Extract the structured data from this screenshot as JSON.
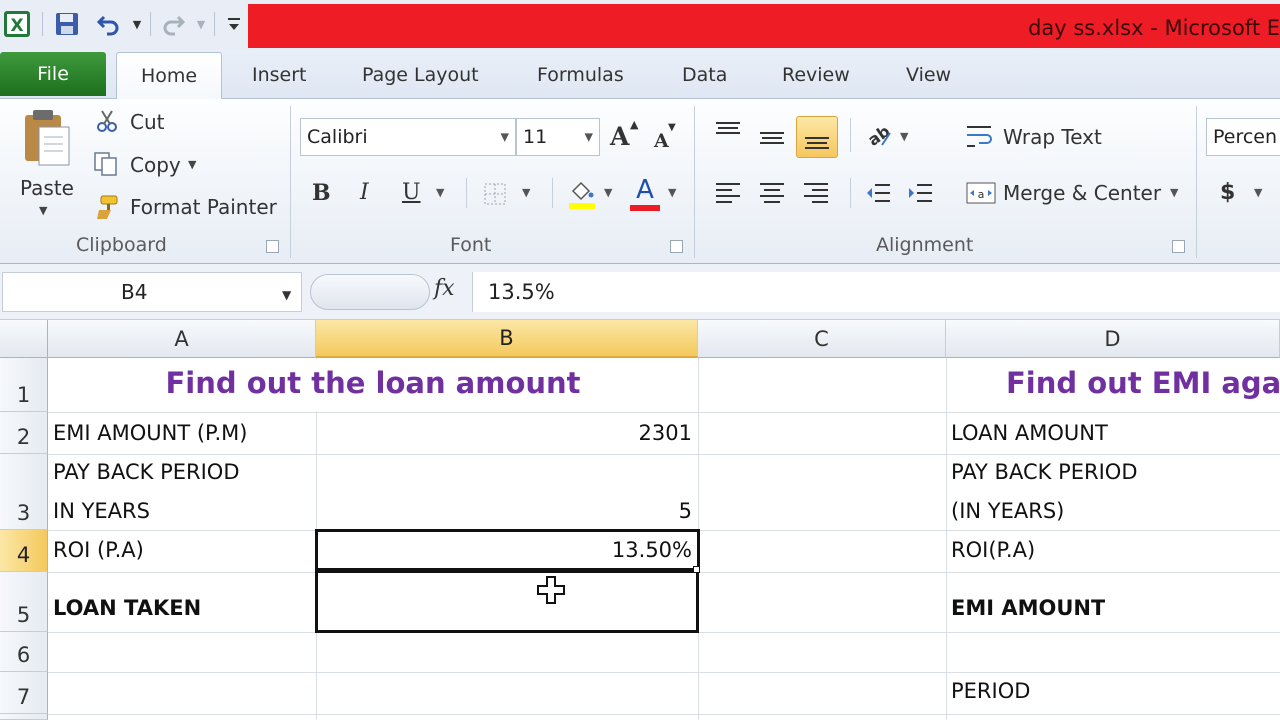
{
  "window": {
    "title": "day ss.xlsx  -  Microsoft E"
  },
  "tabs": [
    "File",
    "Home",
    "Insert",
    "Page Layout",
    "Formulas",
    "Data",
    "Review",
    "View"
  ],
  "clipboard": {
    "paste": "Paste",
    "cut": "Cut",
    "copy": "Copy",
    "format_painter": "Format Painter",
    "group_label": "Clipboard"
  },
  "font": {
    "name": "Calibri",
    "size": "11",
    "group_label": "Font",
    "bold": "B",
    "italic": "I",
    "underline": "U",
    "font_color_glyph": "A",
    "grow_glyph": "A",
    "shrink_glyph": "A"
  },
  "alignment": {
    "wrap_text": "Wrap Text",
    "merge_center": "Merge & Center",
    "group_label": "Alignment"
  },
  "number": {
    "format": "Percen",
    "currency_glyph": "$"
  },
  "formula_bar": {
    "name_box": "B4",
    "fx": "fx",
    "value": "13.5%"
  },
  "columns": [
    "A",
    "B",
    "C",
    "D"
  ],
  "rows": [
    "1",
    "2",
    "3",
    "4",
    "5",
    "6",
    "7"
  ],
  "cells": {
    "a1_title": "Find out the loan amount",
    "d1_title": "Find out EMI aga",
    "a2": "EMI AMOUNT (P.M)",
    "b2": "2301",
    "a3_line1": "PAY BACK PERIOD",
    "a3_line2": "IN YEARS",
    "b3": "5",
    "a4": "ROI (P.A)",
    "b4": "13.50%",
    "a5": "LOAN TAKEN",
    "d2": "LOAN AMOUNT",
    "d3_line1": "PAY BACK PERIOD",
    "d3_line2": "(IN YEARS)",
    "d4": "ROI(P.A)",
    "d5": "EMI AMOUNT",
    "d7": "PERIOD"
  },
  "colors": {
    "title_bar": "#ee1c24",
    "file_tab": "#2a7d2a",
    "title_text": "#7030a0",
    "selection_header": "#f4c95d"
  }
}
